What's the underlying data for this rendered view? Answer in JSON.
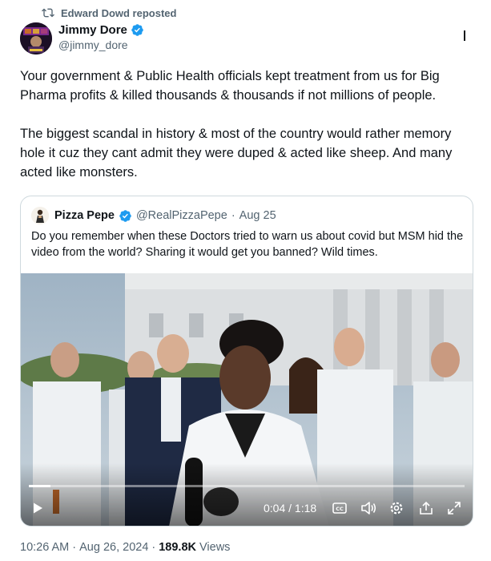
{
  "repost": {
    "text": "Edward Dowd reposted",
    "icon": "repost-icon"
  },
  "tweet": {
    "author_name": "Jimmy Dore",
    "author_handle": "@jimmy_dore",
    "paragraphs": [
      "Your government & Public Health officials kept treatment from us for Big Pharma profits & killed thousands & thousands if not millions of people.",
      "The biggest scandal in history & most of the country would rather memory hole it cuz they cant admit they were duped & acted like sheep. And many acted like monsters."
    ],
    "time": "10:26 AM",
    "sep": "·",
    "date": "Aug 26, 2024",
    "views_count": "189.8K",
    "views_label": "Views"
  },
  "quote": {
    "author_name": "Pizza Pepe",
    "author_handle": "@RealPizzaPepe",
    "sep": "·",
    "date": "Aug 25",
    "text": "Do you remember when these Doctors tried to warn us about covid but MSM hid the video from the world? Sharing it would get you banned? Wild times."
  },
  "video": {
    "time_label": "0:04 / 1:18",
    "progress_fraction": 0.05,
    "controls": [
      "play-icon",
      "captions-icon",
      "volume-icon",
      "settings-icon",
      "share-icon",
      "fullscreen-icon"
    ]
  },
  "colors": {
    "verified": "#1d9bf0",
    "text": "#0f1419",
    "secondary": "#536471",
    "border": "#cfd9de"
  }
}
